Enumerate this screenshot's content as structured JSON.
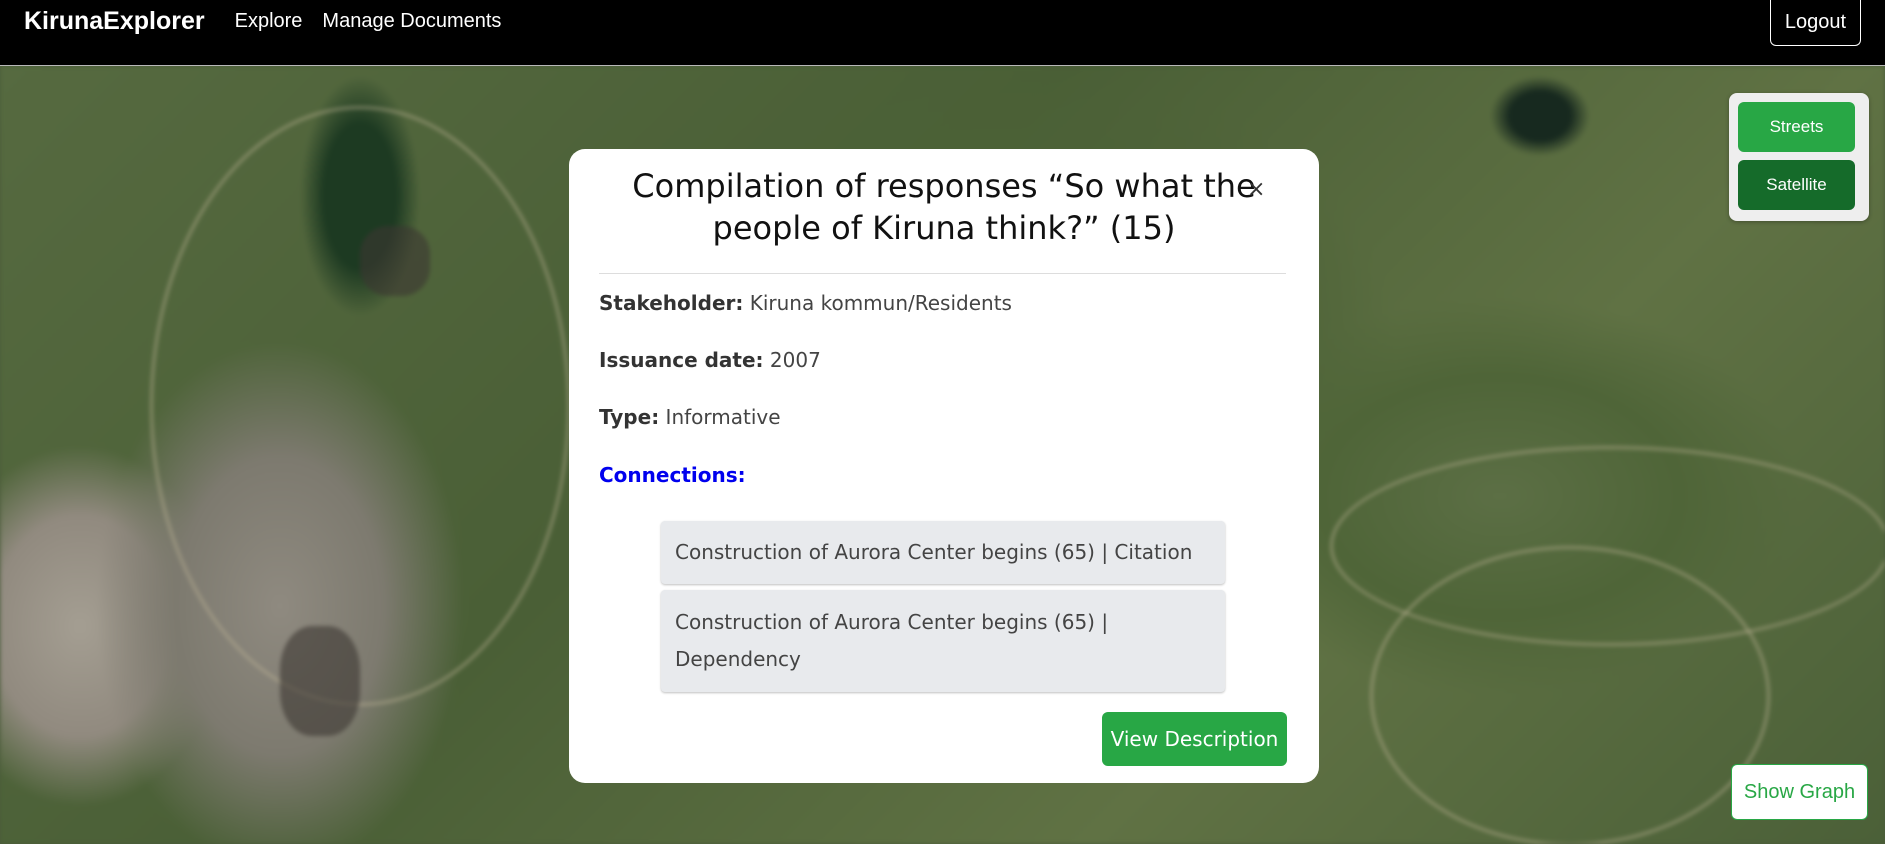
{
  "navbar": {
    "brand": "KirunaExplorer",
    "links": [
      "Explore",
      "Manage Documents"
    ],
    "logout_label": "Logout"
  },
  "map_layers": {
    "streets_label": "Streets",
    "satellite_label": "Satellite",
    "selected": "Satellite"
  },
  "show_graph_label": "Show Graph",
  "modal": {
    "title": "Compilation of responses “So what the people of Kiruna think?” (15)",
    "close_icon": "×",
    "stakeholder_label": "Stakeholder:",
    "stakeholder_value": " Kiruna kommun/Residents",
    "issuance_label": "Issuance date:",
    "issuance_value": " 2007",
    "type_label": "Type:",
    "type_value": " Informative",
    "connections_label": "Connections:",
    "connections": [
      "Construction of Aurora Center begins (65) | Citation",
      "Construction of Aurora Center begins (65) | Dependency"
    ],
    "view_description_label": "View Description"
  },
  "colors": {
    "accent_green": "#28a745",
    "satellite_active": "#156b2a",
    "connections_blue": "#0000ee"
  }
}
